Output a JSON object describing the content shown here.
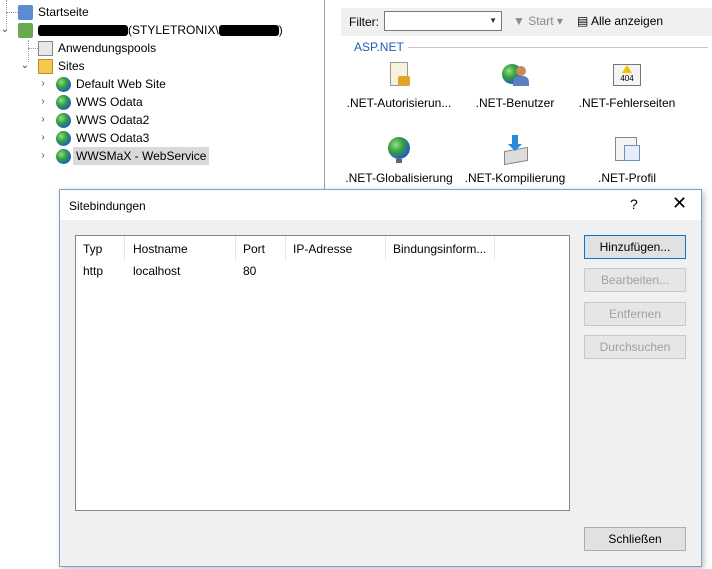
{
  "tree": {
    "startpage": "Startseite",
    "server_suffix": "(STYLETRONIX\\",
    "server_end": ")",
    "app_pools": "Anwendungspools",
    "sites": "Sites",
    "site_items": [
      "Default Web Site",
      "WWS Odata",
      "WWS Odata2",
      "WWS Odata3",
      "WWSMaX - WebService"
    ]
  },
  "features": {
    "filter_label": "Filter:",
    "start_label": "Start",
    "show_all_label": "Alle anzeigen",
    "section": "ASP.NET",
    "items": [
      ".NET-Autorisierun...",
      ".NET-Benutzer",
      ".NET-Fehlerseiten",
      ".NET-Globalisierung",
      ".NET-Kompilierung",
      ".NET-Profil"
    ],
    "error_icon_text": "404"
  },
  "dialog": {
    "title": "Sitebindungen",
    "help": "?",
    "close": "✕",
    "columns": [
      "Typ",
      "Hostname",
      "Port",
      "IP-Adresse",
      "Bindungsinform..."
    ],
    "rows": [
      {
        "type": "http",
        "hostname": "localhost",
        "port": "80",
        "ip": "",
        "info": ""
      }
    ],
    "buttons": {
      "add": "Hinzufügen...",
      "edit": "Bearbeiten...",
      "remove": "Entfernen",
      "browse": "Durchsuchen",
      "close": "Schließen"
    }
  }
}
